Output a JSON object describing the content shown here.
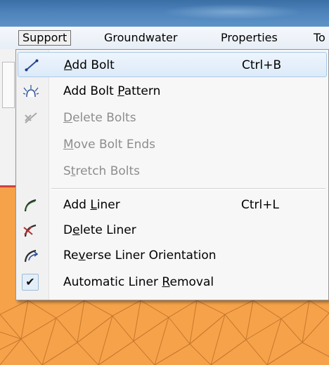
{
  "menubar": {
    "items": [
      {
        "label": "Support",
        "active": true
      },
      {
        "label": "Groundwater"
      },
      {
        "label": "Properties"
      },
      {
        "label": "To"
      }
    ]
  },
  "support_menu": {
    "items": [
      {
        "pre": "",
        "u": "A",
        "post": "dd Bolt",
        "shortcut": "Ctrl+B",
        "icon": "add-bolt-icon",
        "enabled": true,
        "highlighted": true
      },
      {
        "pre": "Add Bolt ",
        "u": "P",
        "post": "attern",
        "shortcut": "",
        "icon": "add-bolt-pattern-icon",
        "enabled": true
      },
      {
        "pre": "",
        "u": "D",
        "post": "elete Bolts",
        "shortcut": "",
        "icon": "delete-bolts-icon",
        "enabled": false
      },
      {
        "pre": "",
        "u": "M",
        "post": "ove Bolt Ends",
        "shortcut": "",
        "icon": "",
        "enabled": false
      },
      {
        "pre": "S",
        "u": "t",
        "post": "retch Bolts",
        "shortcut": "",
        "icon": "",
        "enabled": false
      },
      {
        "pre": "Add ",
        "u": "L",
        "post": "iner",
        "shortcut": "Ctrl+L",
        "icon": "add-liner-icon",
        "enabled": true
      },
      {
        "pre": "D",
        "u": "e",
        "post": "lete Liner",
        "shortcut": "",
        "icon": "delete-liner-icon",
        "enabled": true
      },
      {
        "pre": "Re",
        "u": "v",
        "post": "erse Liner Orientation",
        "shortcut": "",
        "icon": "reverse-liner-icon",
        "enabled": true
      },
      {
        "pre": "Automatic Liner ",
        "u": "R",
        "post": "emoval",
        "shortcut": "",
        "icon": "checkmark-icon",
        "enabled": true,
        "checked": true
      }
    ]
  },
  "colors": {
    "titlebar": "#4d83ba",
    "highlight": "#dceaf8",
    "disabled_text": "#8d8d8d",
    "mesh_orange": "#f6a24a"
  }
}
